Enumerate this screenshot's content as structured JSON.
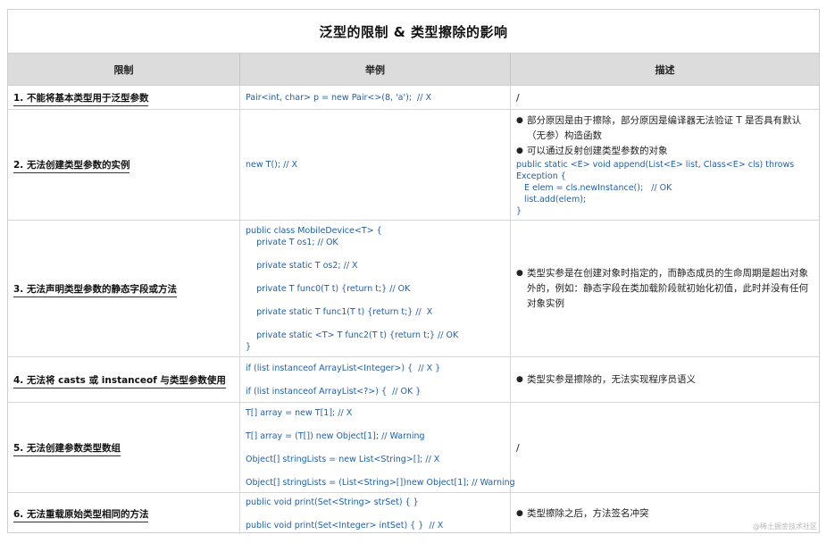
{
  "title": "泛型的限制 & 类型擦除的影响",
  "headers": [
    "限制",
    "举例",
    "描述"
  ],
  "rows": [
    {
      "limit": "1. 不能将基本类型用于泛型参数",
      "example": "Pair<int, char> p = new Pair<>(8, 'a');  // X",
      "desc_plain": "/"
    },
    {
      "limit": "2. 无法创建类型参数的实例",
      "example": "new T(); // X",
      "bullets": [
        "部分原因是由于擦除，部分原因是编译器无法验证 T 是否具有默认（无参）构造函数",
        "可以通过反射创建类型参数的对象"
      ],
      "desc_code": "public static <E> void append(List<E> list, Class<E> cls) throws\nException {\n   E elem = cls.newInstance();   // OK\n   list.add(elem);\n}"
    },
    {
      "limit": "3. 无法声明类型参数的静态字段或方法",
      "example": "public class MobileDevice<T> {\n    private T os1; // OK\n\n    private static T os2; // X\n\n    private T func0(T t) {return t;} // OK\n\n    private static T func1(T t) {return t;} //  X\n\n    private static <T> T func2(T t) {return t;} // OK\n}",
      "bullets": [
        "类型实参是在创建对象时指定的，而静态成员的生命周期是超出对象外的，例如：静态字段在类加载阶段就初始化初值，此时并没有任何对象实例"
      ]
    },
    {
      "limit": "4. 无法将 casts 或 instanceof 与类型参数使用",
      "example": "if (list instanceof ArrayList<Integer>) {  // X }\n\nif (list instanceof ArrayList<?>) {  // OK }",
      "bullets": [
        "类型实参是擦除的，无法实现程序员语义"
      ]
    },
    {
      "limit": "5. 无法创建参数类型数组",
      "example": "T[] array = new T[1]; // X\n\nT[] array = (T[]) new Object[1]; // Warning\n\nObject[] stringLists = new List<String>[]; // X\n\nObject[] stringLists = (List<String>[])new Object[1]; // Warning",
      "desc_plain": "/"
    },
    {
      "limit": "6. 无法重载原始类型相同的方法",
      "example": "public void print(Set<String> strSet) { }\n\npublic void print(Set<Integer> intSet) { }  // X",
      "bullets": [
        "类型擦除之后，方法签名冲突"
      ]
    }
  ],
  "watermark": "@稀土掘金技术社区"
}
